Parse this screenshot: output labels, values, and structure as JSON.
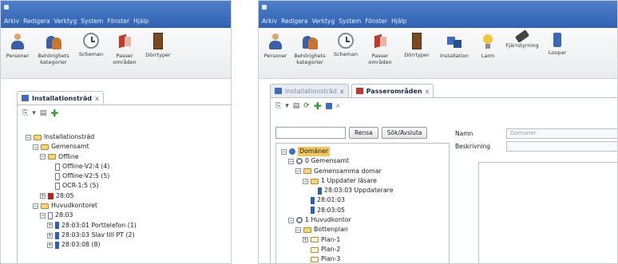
{
  "left": {
    "menu": [
      "Arkiv",
      "Redigera",
      "Verktyg",
      "System",
      "Fönster",
      "Hjälp"
    ],
    "tools": [
      {
        "icon": "person-icon",
        "label": "Personer"
      },
      {
        "icon": "group-icon",
        "label": "Behörighets kategorier"
      },
      {
        "icon": "clock-icon",
        "label": "Scheman"
      },
      {
        "icon": "passage-icon",
        "label": "Passer områden"
      },
      {
        "icon": "door-icon",
        "label": "Dörrtyper"
      }
    ],
    "tab": {
      "label": "Installationsträd",
      "close": "x"
    },
    "tree": [
      {
        "depth": 0,
        "exp": "−",
        "icon": "folder",
        "label": "Installationsträd"
      },
      {
        "depth": 1,
        "exp": "−",
        "icon": "folder",
        "label": "Gemensamt"
      },
      {
        "depth": 2,
        "exp": "−",
        "icon": "folder",
        "label": "Offline"
      },
      {
        "depth": 3,
        "exp": "",
        "icon": "leaf",
        "label": "Offline-V2:4 (4)"
      },
      {
        "depth": 3,
        "exp": "",
        "icon": "leaf",
        "label": "Offline-V2:5 (5)"
      },
      {
        "depth": 3,
        "exp": "",
        "icon": "leaf",
        "label": "OCR-1:5 (5)"
      },
      {
        "depth": 2,
        "exp": "+",
        "icon": "red",
        "label": "28:05"
      },
      {
        "depth": 1,
        "exp": "−",
        "icon": "folder",
        "label": "Huvudkontoret"
      },
      {
        "depth": 2,
        "exp": "−",
        "icon": "leaf",
        "label": "28:03"
      },
      {
        "depth": 3,
        "exp": "+",
        "icon": "blue",
        "label": "28:03:01 Porttelefon (1)"
      },
      {
        "depth": 3,
        "exp": "+",
        "icon": "blue",
        "label": "28:03:03 Slav till PT (2)"
      },
      {
        "depth": 3,
        "exp": "+",
        "icon": "blue",
        "label": "28:03:08 (8)"
      }
    ]
  },
  "right": {
    "menu": [
      "Arkiv",
      "Redigera",
      "Verktyg",
      "System",
      "Fönster",
      "Hjälp"
    ],
    "tools": [
      {
        "icon": "person-icon",
        "label": "Personer"
      },
      {
        "icon": "group-icon",
        "label": "Behörighets kategorier"
      },
      {
        "icon": "clock-icon",
        "label": "Scheman"
      },
      {
        "icon": "passage-icon",
        "label": "Passer områden"
      },
      {
        "icon": "door-icon",
        "label": "Dörrtyper"
      },
      {
        "icon": "installation-icon",
        "label": "Installation"
      },
      {
        "icon": "bulb-icon",
        "label": "Larm"
      },
      {
        "icon": "remote-icon",
        "label": "Fjärrstyrning"
      },
      {
        "icon": "loop-icon",
        "label": "Loopar"
      }
    ],
    "tabs": [
      {
        "label": "Installationsträd",
        "close": "x"
      },
      {
        "label": "Passerområden",
        "close": "x"
      }
    ],
    "search_button": "Rensa",
    "search_button2": "Sök/Avsluta",
    "tree": [
      {
        "depth": 0,
        "exp": "−",
        "icon": "globe",
        "label": "Domäner",
        "selected": true
      },
      {
        "depth": 1,
        "exp": "−",
        "icon": "gear",
        "label": "0 Gemensamt"
      },
      {
        "depth": 2,
        "exp": "−",
        "icon": "folder",
        "label": "Gemensamma domar"
      },
      {
        "depth": 3,
        "exp": "−",
        "icon": "folder",
        "label": "1 Uppdater läsare"
      },
      {
        "depth": 4,
        "exp": "",
        "icon": "blue",
        "label": "28:03:03 Uppdaterare"
      },
      {
        "depth": 3,
        "exp": "",
        "icon": "blue",
        "label": "28:01:03"
      },
      {
        "depth": 3,
        "exp": "",
        "icon": "blue",
        "label": "28:03:05"
      },
      {
        "depth": 1,
        "exp": "−",
        "icon": "gear",
        "label": "1 Huvudkontor"
      },
      {
        "depth": 2,
        "exp": "−",
        "icon": "folder",
        "label": "Bottenplan"
      },
      {
        "depth": 3,
        "exp": "+",
        "icon": "folder-empty",
        "label": "Plan-1"
      },
      {
        "depth": 3,
        "exp": "",
        "icon": "folder-empty",
        "label": "Plan-2"
      },
      {
        "depth": 3,
        "exp": "",
        "icon": "folder-empty",
        "label": "Plan-3"
      }
    ],
    "form": {
      "name_label": "Namn",
      "name_value": "Domaner",
      "desc_label": "Beskrivning"
    }
  }
}
